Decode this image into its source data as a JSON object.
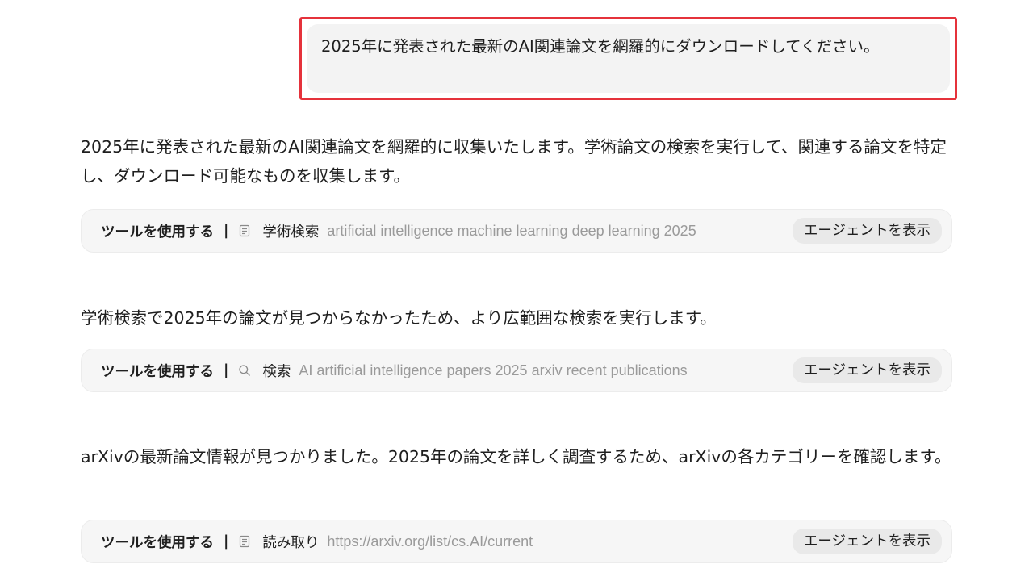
{
  "user_message": {
    "text": "2025年に発表された最新のAI関連論文を網羅的にダウンロードしてください。"
  },
  "messages": [
    {
      "text": "2025年に発表された最新のAI関連論文を網羅的に収集いたします。学術論文の検索を実行して、関連する論文を特定し、ダウンロード可能なものを収集します。",
      "tool": {
        "label": "ツールを使用する",
        "separator": "|",
        "icon": "document-icon",
        "name": "学術検索",
        "argument": "artificial intelligence machine learning deep learning 2025",
        "action": "エージェントを表示"
      }
    },
    {
      "text": "学術検索で2025年の論文が見つからなかったため、より広範囲な検索を実行します。",
      "tool": {
        "label": "ツールを使用する",
        "separator": "|",
        "icon": "search-icon",
        "name": "検索",
        "argument": "AI artificial intelligence papers 2025 arxiv recent publications",
        "action": "エージェントを表示"
      }
    },
    {
      "text": "arXivの最新論文情報が見つかりました。2025年の論文を詳しく調査するため、arXivの各カテゴリーを確認します。",
      "tool": {
        "label": "ツールを使用する",
        "separator": "|",
        "icon": "document-icon",
        "name": "読み取り",
        "argument": "https://arxiv.org/list/cs.AI/current",
        "action": "エージェントを表示"
      }
    }
  ],
  "colors": {
    "highlight_border": "#e5323b",
    "bubble_bg": "#f3f3f3",
    "tool_bg": "#f6f6f6",
    "argument_text": "#9a9a9a"
  }
}
